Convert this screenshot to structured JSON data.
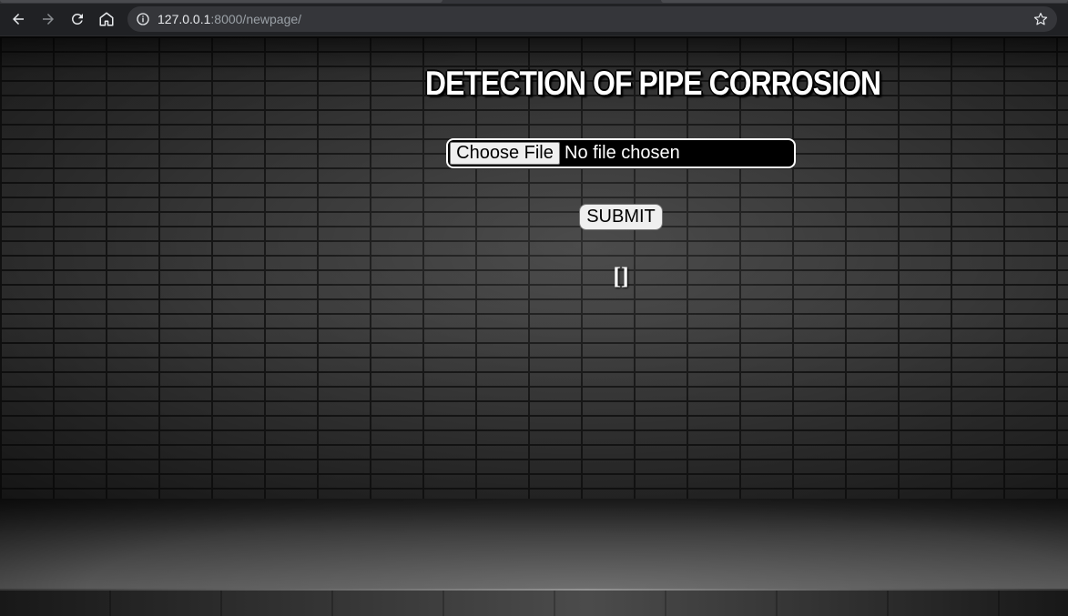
{
  "browser": {
    "back_icon": "arrow-left-icon",
    "forward_icon": "arrow-right-icon",
    "reload_icon": "reload-icon",
    "home_icon": "home-icon",
    "info_icon": "info-icon",
    "bookmark_icon": "star-icon",
    "url_host": "127.0.0.1",
    "url_rest": ":8000/newpage/"
  },
  "page": {
    "title": "DETECTION OF PIPE CORROSION",
    "file_input": {
      "button_label": "Choose File",
      "status": "No file chosen"
    },
    "submit_label": "SUBMIT",
    "result": "[]"
  }
}
